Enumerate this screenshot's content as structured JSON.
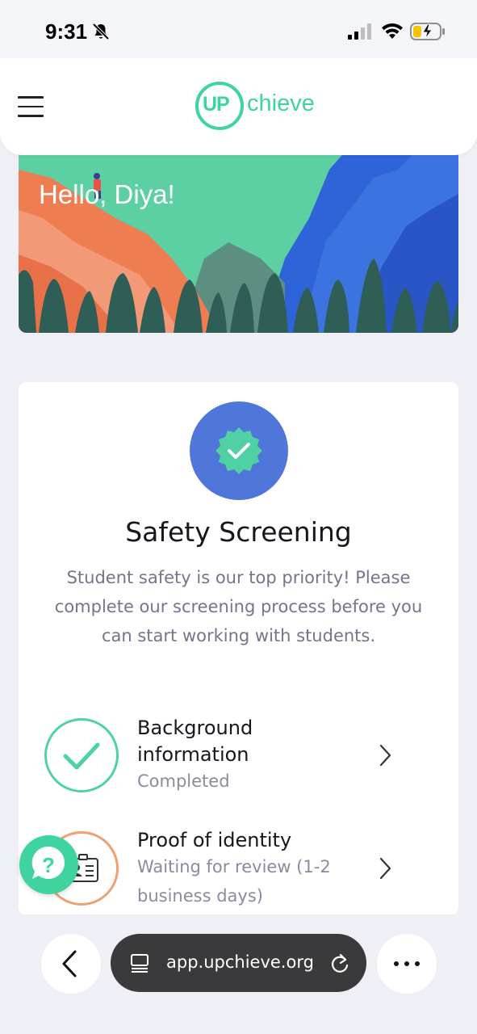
{
  "status_bar": {
    "time": "9:31",
    "icons": [
      "bell-slash-icon",
      "signal-icon",
      "wifi-icon",
      "battery-charging-icon"
    ]
  },
  "header": {
    "logo_up": "UP",
    "logo_rest": "chieve",
    "menu_icon": "hamburger-icon"
  },
  "hero": {
    "greeting": "Hello, Diya!"
  },
  "screening": {
    "title": "Safety Screening",
    "description": "Student safety is our top priority! Please complete our screening process before you can start working with students.",
    "steps": [
      {
        "title_line1": "Background",
        "title_line2": "information",
        "status": "Completed",
        "icon": "checkmark-icon",
        "state_color": "#4fd1a5"
      },
      {
        "title": "Proof of identity",
        "status_line1": "Waiting for review (1-2",
        "status_line2": "business days)",
        "icon": "id-card-icon",
        "state_color": "#f0a070"
      }
    ]
  },
  "help": {
    "icon": "question-chat-icon"
  },
  "browser": {
    "url": "app.upchieve.org",
    "icons": [
      "back-arrow-icon",
      "tabs-icon",
      "reload-icon",
      "more-icon"
    ]
  },
  "colors": {
    "brand_green": "#3fd3a0",
    "badge_blue": "#4f76d9",
    "completed_green": "#4fd1a5",
    "pending_orange": "#f0a070"
  }
}
